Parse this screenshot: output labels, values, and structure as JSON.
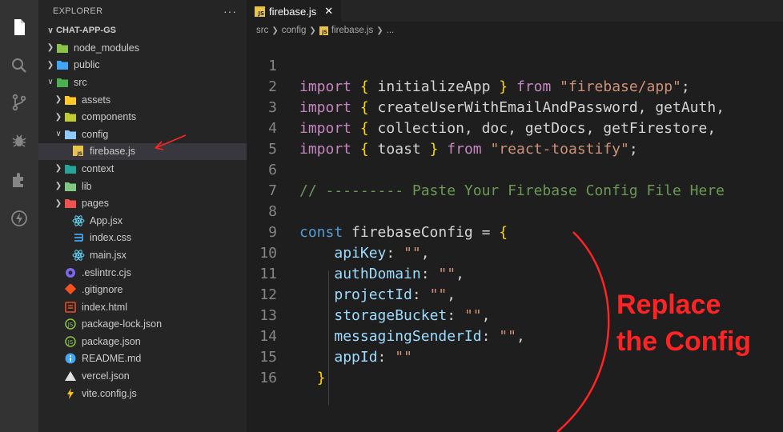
{
  "activity_bar": {
    "icons": [
      "files-icon",
      "search-icon",
      "source-control-icon",
      "debug-icon",
      "extensions-icon",
      "thunder-icon"
    ]
  },
  "explorer": {
    "title": "EXPLORER",
    "more": "···",
    "root": "CHAT-APP-GS",
    "items": [
      {
        "label": "node_modules",
        "depth": 1,
        "type": "folder",
        "expanded": false,
        "color": "#8bc34a"
      },
      {
        "label": "public",
        "depth": 1,
        "type": "folder",
        "expanded": false,
        "color": "#42a5f5"
      },
      {
        "label": "src",
        "depth": 1,
        "type": "folder",
        "expanded": true,
        "color": "#4caf50"
      },
      {
        "label": "assets",
        "depth": 2,
        "type": "folder",
        "expanded": false,
        "color": "#ffca28"
      },
      {
        "label": "components",
        "depth": 2,
        "type": "folder",
        "expanded": false,
        "color": "#c0ca33"
      },
      {
        "label": "config",
        "depth": 2,
        "type": "folder",
        "expanded": true,
        "color": "#90caf9"
      },
      {
        "label": "firebase.js",
        "depth": 3,
        "type": "js",
        "selected": true
      },
      {
        "label": "context",
        "depth": 2,
        "type": "folder",
        "expanded": false,
        "color": "#26a69a"
      },
      {
        "label": "lib",
        "depth": 2,
        "type": "folder",
        "expanded": false,
        "color": "#81c784"
      },
      {
        "label": "pages",
        "depth": 2,
        "type": "folder",
        "expanded": false,
        "color": "#ef5350"
      },
      {
        "label": "App.jsx",
        "depth": 3,
        "type": "react"
      },
      {
        "label": "index.css",
        "depth": 3,
        "type": "css"
      },
      {
        "label": "main.jsx",
        "depth": 3,
        "type": "react"
      },
      {
        "label": ".eslintrc.cjs",
        "depth": 2,
        "type": "eslint"
      },
      {
        "label": ".gitignore",
        "depth": 2,
        "type": "git"
      },
      {
        "label": "index.html",
        "depth": 2,
        "type": "html"
      },
      {
        "label": "package-lock.json",
        "depth": 2,
        "type": "npm"
      },
      {
        "label": "package.json",
        "depth": 2,
        "type": "npm"
      },
      {
        "label": "README.md",
        "depth": 2,
        "type": "info"
      },
      {
        "label": "vercel.json",
        "depth": 2,
        "type": "vercel"
      },
      {
        "label": "vite.config.js",
        "depth": 2,
        "type": "vite"
      }
    ]
  },
  "editor": {
    "tab": {
      "icon": "JS",
      "label": "firebase.js",
      "close": "✕"
    },
    "breadcrumb": [
      "src",
      "config",
      "firebase.js",
      "..."
    ],
    "lines": [
      {
        "n": "1",
        "tokens": []
      },
      {
        "n": "2",
        "tokens": [
          [
            "kw2",
            "import"
          ],
          [
            "p",
            " "
          ],
          [
            "br",
            "{"
          ],
          [
            "p",
            " initializeApp "
          ],
          [
            "br",
            "}"
          ],
          [
            "p",
            " "
          ],
          [
            "kw2",
            "from"
          ],
          [
            "p",
            " "
          ],
          [
            "str",
            "\"firebase/app\""
          ],
          [
            "p",
            ";"
          ]
        ]
      },
      {
        "n": "3",
        "tokens": [
          [
            "kw2",
            "import"
          ],
          [
            "p",
            " "
          ],
          [
            "br",
            "{"
          ],
          [
            "p",
            " createUserWithEmailAndPassword, getAuth, "
          ]
        ]
      },
      {
        "n": "4",
        "tokens": [
          [
            "kw2",
            "import"
          ],
          [
            "p",
            " "
          ],
          [
            "br",
            "{"
          ],
          [
            "p",
            " collection, doc, getDocs, getFirestore, "
          ]
        ]
      },
      {
        "n": "5",
        "tokens": [
          [
            "kw2",
            "import"
          ],
          [
            "p",
            " "
          ],
          [
            "br",
            "{"
          ],
          [
            "p",
            " toast "
          ],
          [
            "br",
            "}"
          ],
          [
            "p",
            " "
          ],
          [
            "kw2",
            "from"
          ],
          [
            "p",
            " "
          ],
          [
            "str",
            "\"react-toastify\""
          ],
          [
            "p",
            ";"
          ]
        ]
      },
      {
        "n": "6",
        "tokens": []
      },
      {
        "n": "7",
        "tokens": [
          [
            "cmt",
            "// --------- Paste Your Firebase Config File Here"
          ]
        ]
      },
      {
        "n": "8",
        "tokens": []
      },
      {
        "n": "9",
        "tokens": [
          [
            "kw",
            "const"
          ],
          [
            "p",
            " firebaseConfig = "
          ],
          [
            "br",
            "{"
          ]
        ]
      },
      {
        "n": "10",
        "tokens": [
          [
            "p",
            "    "
          ],
          [
            "prop",
            "apiKey"
          ],
          [
            "p",
            ": "
          ],
          [
            "str",
            "\"\""
          ],
          [
            "p",
            ","
          ]
        ]
      },
      {
        "n": "11",
        "tokens": [
          [
            "p",
            "    "
          ],
          [
            "prop",
            "authDomain"
          ],
          [
            "p",
            ": "
          ],
          [
            "str",
            "\"\""
          ],
          [
            "p",
            ","
          ]
        ]
      },
      {
        "n": "12",
        "tokens": [
          [
            "p",
            "    "
          ],
          [
            "prop",
            "projectId"
          ],
          [
            "p",
            ": "
          ],
          [
            "str",
            "\"\""
          ],
          [
            "p",
            ","
          ]
        ]
      },
      {
        "n": "13",
        "tokens": [
          [
            "p",
            "    "
          ],
          [
            "prop",
            "storageBucket"
          ],
          [
            "p",
            ": "
          ],
          [
            "str",
            "\"\""
          ],
          [
            "p",
            ","
          ]
        ]
      },
      {
        "n": "14",
        "tokens": [
          [
            "p",
            "    "
          ],
          [
            "prop",
            "messagingSenderId"
          ],
          [
            "p",
            ": "
          ],
          [
            "str",
            "\"\""
          ],
          [
            "p",
            ","
          ]
        ]
      },
      {
        "n": "15",
        "tokens": [
          [
            "p",
            "    "
          ],
          [
            "prop",
            "appId"
          ],
          [
            "p",
            ": "
          ],
          [
            "str",
            "\"\""
          ]
        ]
      },
      {
        "n": "16",
        "tokens": [
          [
            "p",
            "  "
          ],
          [
            "br",
            "}"
          ]
        ]
      }
    ]
  },
  "annotation": {
    "line1": "Replace",
    "line2": "the Config",
    "color": "#ff2424"
  }
}
